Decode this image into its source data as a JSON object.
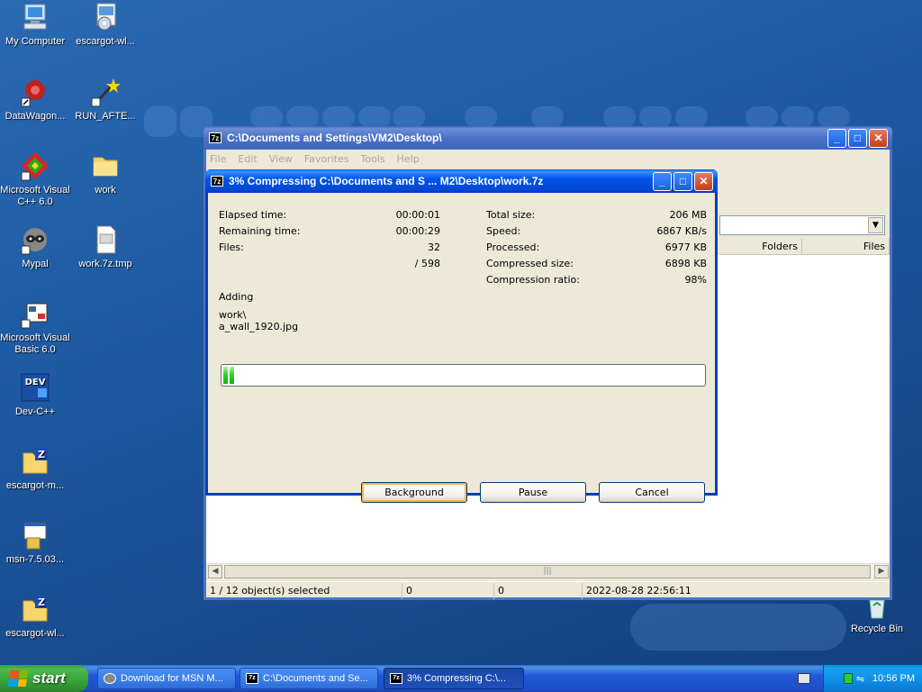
{
  "desktop": {
    "icons": [
      {
        "label": "My Computer"
      },
      {
        "label": "escargot-wl..."
      },
      {
        "label": "DataWagon..."
      },
      {
        "label": "RUN_AFTE..."
      },
      {
        "label": "Microsoft Visual C++ 6.0"
      },
      {
        "label": "work"
      },
      {
        "label": "Mypal"
      },
      {
        "label": "work.7z.tmp"
      },
      {
        "label": "Microsoft Visual Basic 6.0"
      },
      {
        "label": "Dev-C++"
      },
      {
        "label": "escargot-m..."
      },
      {
        "label": "msn-7.5.03..."
      },
      {
        "label": "escargot-wl..."
      },
      {
        "label": "Recycle Bin"
      }
    ]
  },
  "main_window": {
    "title": "C:\\Documents and Settings\\VM2\\Desktop\\",
    "app_icon": "7z",
    "menu": [
      "File",
      "Edit",
      "View",
      "Favorites",
      "Tools",
      "Help"
    ],
    "columns": {
      "folders": "Folders",
      "files": "Files"
    },
    "status": {
      "selected": "1 / 12 object(s) selected",
      "size": "0",
      "packed": "0",
      "modified": "2022-08-28 22:56:11"
    }
  },
  "progress_dialog": {
    "title": "3% Compressing C:\\Documents and S ... M2\\Desktop\\work.7z",
    "elapsed_label": "Elapsed time:",
    "elapsed_value": "00:00:01",
    "remaining_label": "Remaining time:",
    "remaining_value": "00:00:29",
    "files_label": "Files:",
    "files_value": "32",
    "files_total": "/ 598",
    "total_size_label": "Total size:",
    "total_size_value": "206 MB",
    "speed_label": "Speed:",
    "speed_value": "6867 KB/s",
    "processed_label": "Processed:",
    "processed_value": "6977 KB",
    "compressed_label": "Compressed size:",
    "compressed_value": "6898 KB",
    "ratio_label": "Compression ratio:",
    "ratio_value": "98%",
    "operation": "Adding",
    "current_dir": "work\\",
    "current_file": "a_wall_1920.jpg",
    "progress_percent": 3,
    "buttons": {
      "background": "Background",
      "pause": "Pause",
      "cancel": "Cancel"
    }
  },
  "taskbar": {
    "start_label": "start",
    "tasks": [
      {
        "label": "Download for MSN M..."
      },
      {
        "label": "C:\\Documents and Se..."
      },
      {
        "label": "3% Compressing C:\\..."
      }
    ],
    "clock": "10:56 PM"
  }
}
